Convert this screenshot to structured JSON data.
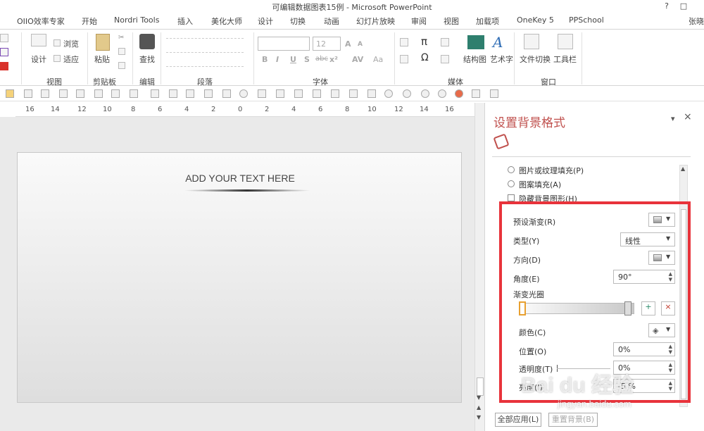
{
  "window": {
    "title": "可编辑数据图表15例 - Microsoft PowerPoint",
    "help": "?",
    "restore": "□",
    "user": "张晓"
  },
  "tabs": [
    "OIIO效率专家",
    "开始",
    "Nordri Tools",
    "插入",
    "美化大师",
    "设计",
    "切换",
    "动画",
    "幻灯片放映",
    "审阅",
    "视图",
    "加载项",
    "OneKey 5",
    "PPSchool"
  ],
  "ribbon": {
    "view_group": {
      "design": "设计",
      "browse": "浏览",
      "fit": "适应",
      "label": "视图"
    },
    "clipboard_group": {
      "paste": "粘贴",
      "label": "剪贴板"
    },
    "edit_group": {
      "find": "查找",
      "label": "编辑"
    },
    "paragraph_group": {
      "label": "段落"
    },
    "font_group": {
      "size": "12",
      "bold": "B",
      "italic": "I",
      "underline": "U",
      "strike": "S",
      "abc": "abc",
      "superscript": "x²",
      "spacing": "AV",
      "case": "Aa",
      "grow": "A",
      "shrink": "A",
      "label": "字体"
    },
    "media_group": {
      "pi": "π",
      "omega": "Ω",
      "structure": "结构图",
      "art": "艺术字",
      "label": "媒体"
    },
    "window_group": {
      "switch": "文件切换",
      "toolbar": "工具栏",
      "label": "窗口"
    }
  },
  "ruler": [
    "16",
    "14",
    "12",
    "10",
    "8",
    "6",
    "4",
    "2",
    "0",
    "2",
    "4",
    "6",
    "8",
    "10",
    "12",
    "14",
    "16"
  ],
  "slide": {
    "text": "ADD YOUR TEXT HERE"
  },
  "pane": {
    "title": "设置背景格式",
    "close": "×",
    "menu": "▾",
    "options": {
      "picture_fill": "图片或纹理填充(P)",
      "pattern_fill": "图案填充(A)",
      "hide_bg": "隐藏背景图形(H)"
    },
    "gradient": {
      "preset_label": "预设渐变(R)",
      "type_label": "类型(Y)",
      "type_value": "线性",
      "direction_label": "方向(D)",
      "angle_label": "角度(E)",
      "angle_value": "90°",
      "stops_label": "渐变光圈",
      "color_label": "颜色(C)",
      "position_label": "位置(O)",
      "position_value": "0%",
      "transparency_label": "透明度(T)",
      "transparency_value": "0%",
      "brightness_label": "亮度(I)",
      "brightness_value": "-5 %"
    },
    "apply_all": "全部应用(L)",
    "reset_bg": "重置背景(B)"
  },
  "watermark": {
    "brand": "Bai du 经验",
    "url": "jingyan.baidu.com"
  }
}
